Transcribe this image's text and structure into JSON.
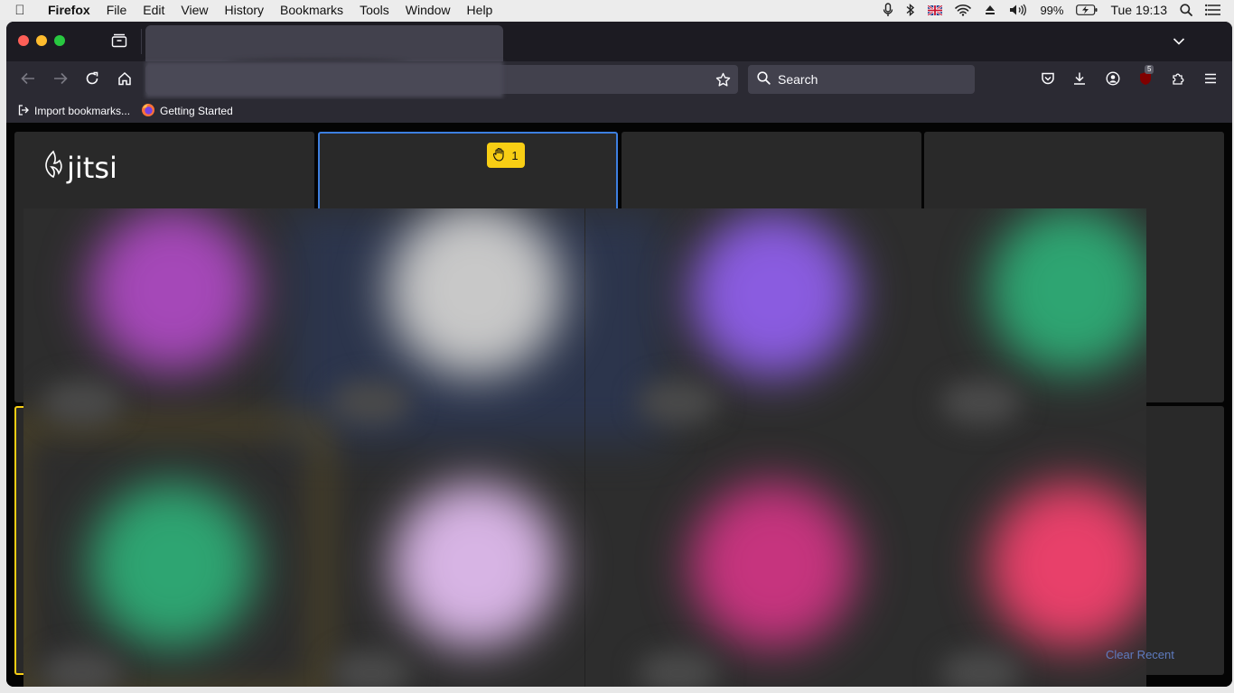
{
  "menubar": {
    "app_name": "Firefox",
    "items": [
      "File",
      "Edit",
      "View",
      "History",
      "Bookmarks",
      "Tools",
      "Window",
      "Help"
    ],
    "battery": "99%",
    "clock": "Tue 19:13"
  },
  "toolbar": {
    "search_placeholder": "Search",
    "extension_badge": "5"
  },
  "bookmarks": {
    "import_label": "Import bookmarks...",
    "getting_started_label": "Getting Started"
  },
  "conference": {
    "logo_text": "jitsi",
    "raised_hands_count": "1",
    "avatar_colors": [
      "#a548b8",
      "#c8c8c8",
      "#8a5ce0",
      "#2ea572",
      "#2ea572",
      "#d7b4e4",
      "#c6347e",
      "#e8406a"
    ],
    "accent_active_speaker": "#3d7fe0",
    "accent_raised_hand": "#f8ce14"
  },
  "footer": {
    "partial_text": "Clear Recent"
  }
}
